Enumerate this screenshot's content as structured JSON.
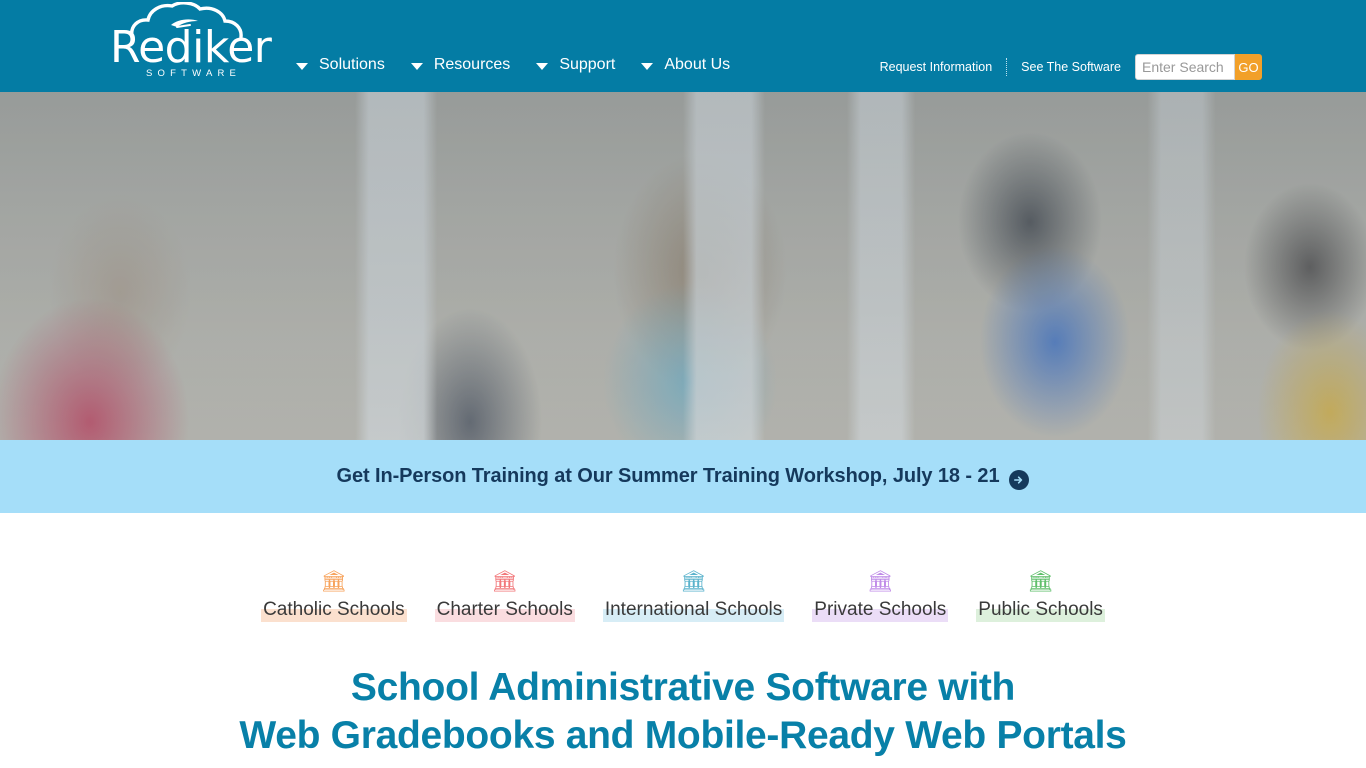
{
  "colors": {
    "header_bg": "#047CA4",
    "banner_bg": "#A5DEF9",
    "banner_text": "#15395c",
    "accent_orange": "#F2A029",
    "headline_teal": "#0880A8"
  },
  "header": {
    "logo": {
      "wordmark": "Rediker",
      "subtext": "SOFTWARE",
      "cloud_icon": "cloud-with-bird-icon"
    },
    "nav": [
      {
        "label": "Solutions",
        "caret": "chevron-down-icon"
      },
      {
        "label": "Resources",
        "caret": "chevron-down-icon"
      },
      {
        "label": "Support",
        "caret": "chevron-down-icon"
      },
      {
        "label": "About Us",
        "caret": "chevron-down-icon"
      }
    ],
    "utility": {
      "request_information": "Request Information",
      "see_the_software": "See The Software"
    },
    "search": {
      "placeholder": "Enter Search",
      "value": "",
      "button_label": "GO"
    }
  },
  "hero": {
    "alt": "Students with backpacks walking through a school breezeway"
  },
  "promo": {
    "text": "Get In-Person Training at Our Summer Training Workshop, July 18 - 21",
    "arrow_icon": "arrow-right-circle-icon"
  },
  "categories": [
    {
      "label": "Catholic Schools",
      "icon": "bank-building-icon",
      "icon_color": "#F7A35C",
      "highlight": "#FBE0CE"
    },
    {
      "label": "Charter Schools",
      "icon": "bank-building-icon",
      "icon_color": "#F2777A",
      "highlight": "#FADDE0"
    },
    {
      "label": "International Schools",
      "icon": "bank-building-icon",
      "icon_color": "#5BB3CC",
      "highlight": "#D7EDF6"
    },
    {
      "label": "Private Schools",
      "icon": "bank-building-icon",
      "icon_color": "#C08CE8",
      "highlight": "#EBDDF7"
    },
    {
      "label": "Public Schools",
      "icon": "bank-building-icon",
      "icon_color": "#5FBF6B",
      "highlight": "#DDF0DC"
    }
  ],
  "headline": {
    "line1": "School Administrative Software with",
    "line2": "Web Gradebooks and Mobile-Ready Web Portals"
  }
}
